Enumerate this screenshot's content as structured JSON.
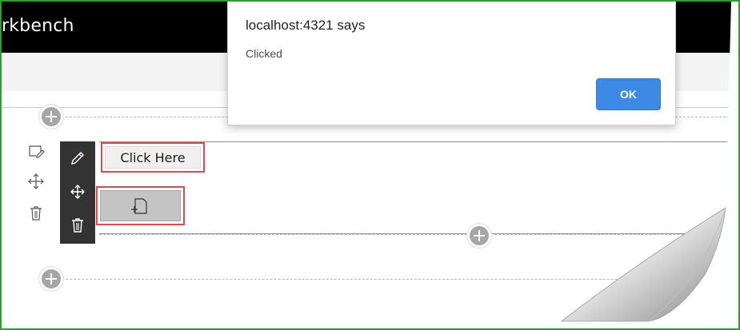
{
  "app": {
    "title": "rkbench"
  },
  "dialog": {
    "title": "localhost:4321 says",
    "message": "Clicked",
    "ok_label": "OK"
  },
  "webpart": {
    "button_label": "Click Here"
  },
  "icons": {
    "add_section": "plus-icon",
    "edit_section": "edit-section-icon",
    "move_section": "move-icon",
    "delete_section": "trash-icon",
    "edit_webpart": "pencil-icon",
    "move_webpart": "move-icon",
    "delete_webpart": "trash-icon",
    "placeholder": "add-webpart-icon"
  },
  "colors": {
    "highlight": "#e8454a",
    "primary_button": "#3d8ae6",
    "toolbar": "#333333",
    "topbar": "#000000",
    "frame": "#2e9e34"
  }
}
